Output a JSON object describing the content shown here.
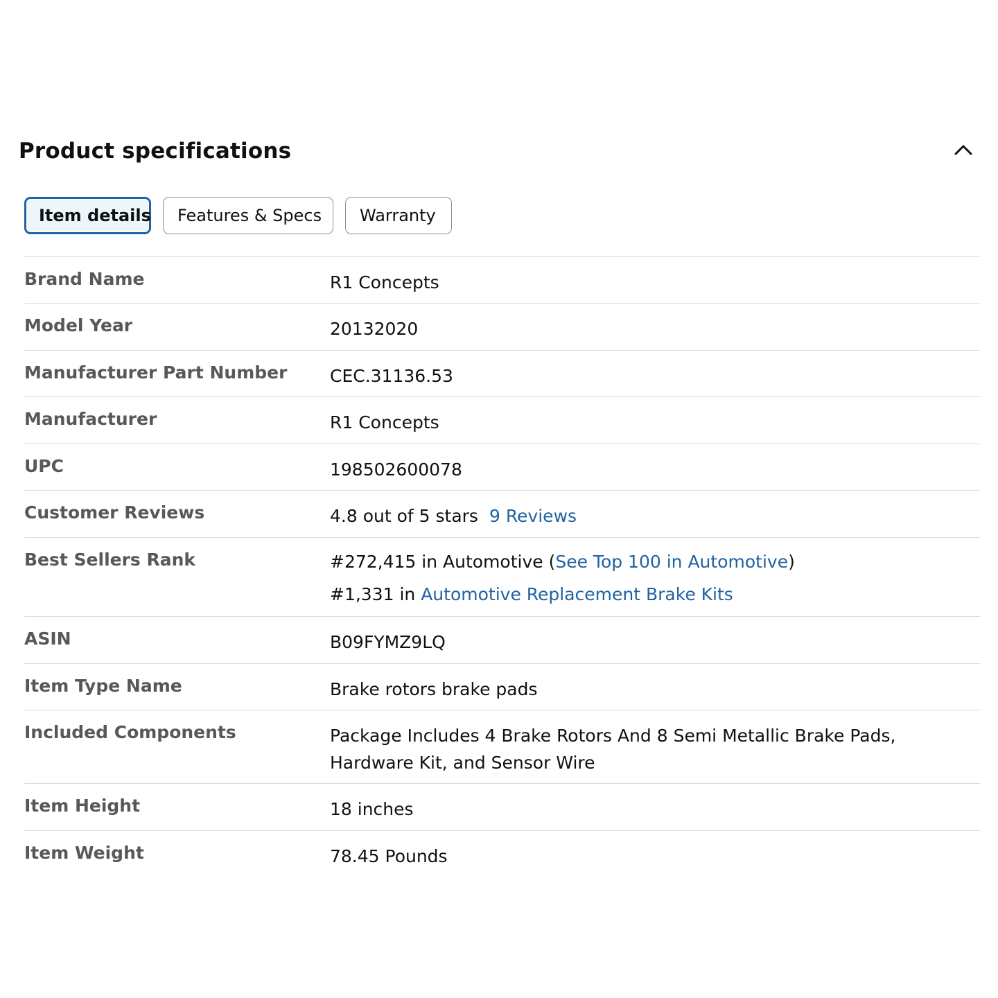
{
  "section": {
    "title": "Product specifications",
    "collapse_icon": "chevron-up-icon"
  },
  "tabs": [
    {
      "label": "Item details",
      "active": true
    },
    {
      "label": "Features & Specs",
      "active": false
    },
    {
      "label": "Warranty",
      "active": false
    }
  ],
  "specs": {
    "brand_name": {
      "label": "Brand Name",
      "value": "R1 Concepts"
    },
    "model_year": {
      "label": "Model Year",
      "value": "20132020"
    },
    "part_number": {
      "label": "Manufacturer Part Number",
      "value": "CEC.31136.53"
    },
    "manufacturer": {
      "label": "Manufacturer",
      "value": "R1 Concepts"
    },
    "upc": {
      "label": "UPC",
      "value": "198502600078"
    },
    "customer_reviews": {
      "label": "Customer Reviews",
      "rating_text": "4.8 out of 5 stars",
      "review_count": "9",
      "reviews_link": "Reviews"
    },
    "best_sellers_rank": {
      "label": "Best Sellers Rank",
      "rank1_text": "#272,415 in Automotive (",
      "rank1_link": "See Top 100 in Automotive",
      "rank1_close": ")",
      "rank2_text": "#1,331 in ",
      "rank2_link": "Automotive Replacement Brake Kits"
    },
    "asin": {
      "label": "ASIN",
      "value": "B09FYMZ9LQ"
    },
    "item_type": {
      "label": "Item Type Name",
      "value": "Brake rotors brake pads"
    },
    "included_components": {
      "label": "Included Components",
      "line1": "Package Includes 4 Brake Rotors And 8 Semi Metallic Brake Pads,",
      "line2": "Hardware Kit, and Sensor Wire"
    },
    "item_height": {
      "label": "Item Height",
      "value": "18 inches"
    },
    "item_weight": {
      "label": "Item Weight",
      "value": "78.45 Pounds"
    }
  },
  "colors": {
    "link": "#2162a1",
    "active_tab_border": "#2162a1",
    "active_tab_bg": "#edf7fb",
    "label": "#565959",
    "divider": "#dcdcdc"
  }
}
